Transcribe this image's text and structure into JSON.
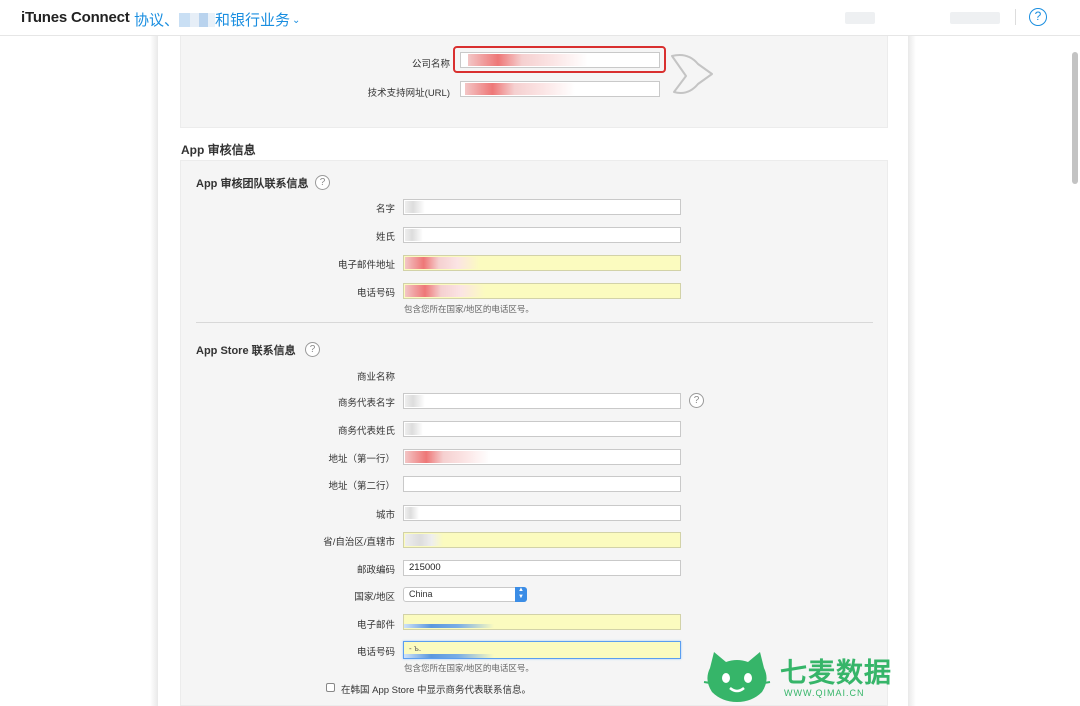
{
  "header": {
    "brand": "iTunes Connect",
    "crumb_left": "协议、",
    "crumb_right": "和银行业务",
    "help_label": "?"
  },
  "company": {
    "company_name_label": "公司名称",
    "support_url_label": "技术支持网址(URL)"
  },
  "review": {
    "section_title": "App 审核信息",
    "team_title": "App 审核团队联系信息",
    "first_name_label": "名字",
    "last_name_label": "姓氏",
    "email_label": "电子邮件地址",
    "phone_label": "电话号码",
    "phone_hint": "包含您所在国家/地区的电话区号。"
  },
  "store": {
    "title": "App Store 联系信息",
    "business_name_label": "商业名称",
    "rep_first_label": "商务代表名字",
    "rep_last_label": "商务代表姓氏",
    "address1_label": "地址（第一行）",
    "address2_label": "地址（第二行）",
    "city_label": "城市",
    "province_label": "省/自治区/直辖市",
    "postal_label": "邮政编码",
    "postal_value": "215000",
    "country_label": "国家/地区",
    "country_value": "China",
    "email_label": "电子邮件",
    "phone_label": "电话号码",
    "phone_value_prefix": "- ъ.",
    "phone_hint": "包含您所在国家/地区的电话区号。",
    "korea_checkbox_label": "在韩国 App Store 中显示商务代表联系信息。"
  },
  "watermark": {
    "name": "七麦数据",
    "url": "WWW.QIMAI.CN"
  },
  "colors": {
    "link_blue": "#1a8ee0",
    "highlight_red": "#d9302f",
    "autofill_yellow": "#fbfbbf",
    "watermark_green": "#36b569"
  }
}
